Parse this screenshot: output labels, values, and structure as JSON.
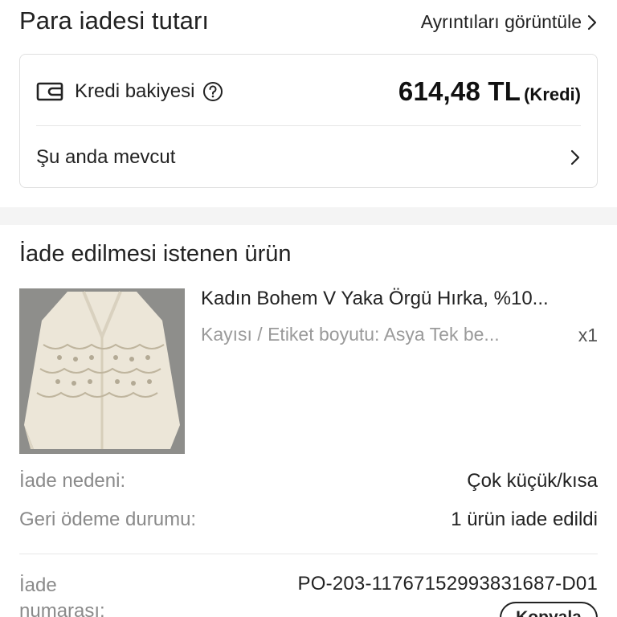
{
  "header": {
    "title": "Para iadesi tutarı",
    "details_link": "Ayrıntıları görüntüle"
  },
  "credit_card": {
    "label": "Kredi bakiyesi",
    "amount": "614,48 TL",
    "amount_suffix": "(Kredi)",
    "available_label": "Şu anda mevcut"
  },
  "product_section": {
    "heading": "İade edilmesi istenen ürün",
    "product": {
      "name": "Kadın Bohem V Yaka Örgü Hırka, %10...",
      "variant": "Kayısı / Etiket boyutu: Asya Tek be...",
      "quantity": "x1"
    }
  },
  "details": {
    "reason_label": "İade nedeni:",
    "reason_value": "Çok küçük/kısa",
    "status_label": "Geri ödeme durumu:",
    "status_value": "1 ürün iade edildi",
    "return_number_label": "İade numarası:",
    "return_number_value": "PO-203-11767152993831687-D01",
    "copy_button": "Kopyala"
  },
  "colors": {
    "text_primary": "#222222",
    "text_secondary": "#8a8a8a",
    "section_gap": "#f4f4f4",
    "border": "#e0e0e0"
  },
  "icons": [
    "wallet-icon",
    "help-icon",
    "chevron-right-icon"
  ]
}
